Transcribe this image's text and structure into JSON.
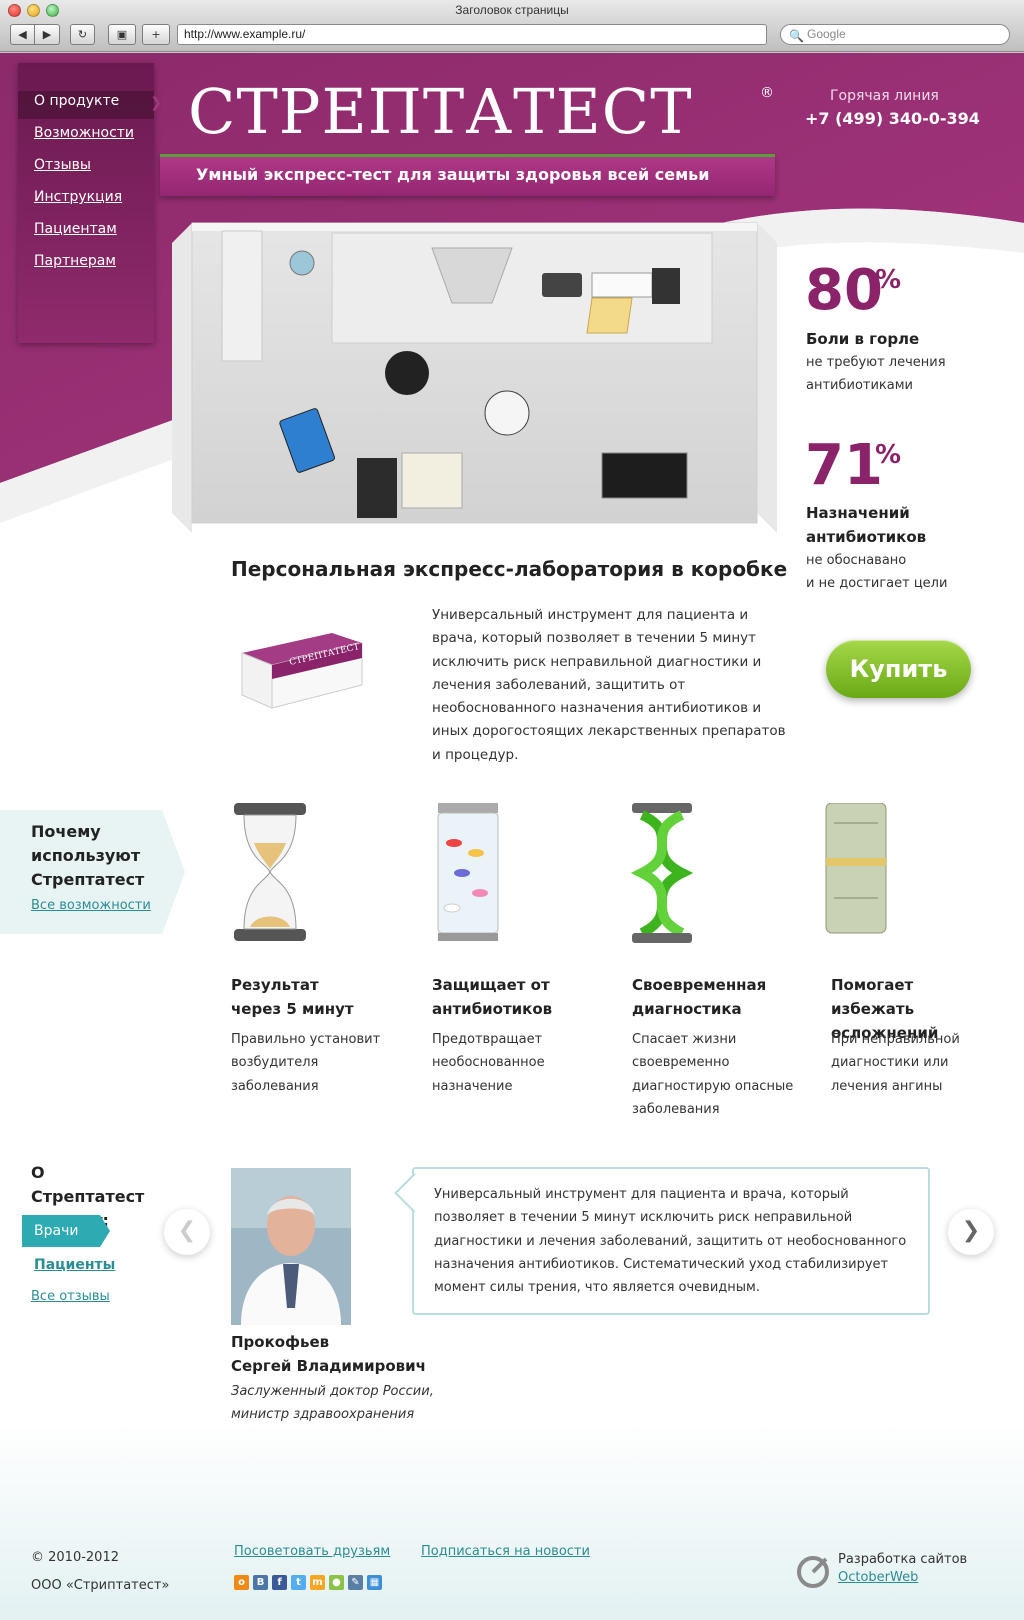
{
  "browser": {
    "window_title": "Заголовок страницы",
    "url": "http://www.example.ru/",
    "search_placeholder": "Google"
  },
  "nav": {
    "items": [
      "О продукте",
      "Возможности",
      "Отзывы",
      "Инструкция",
      "Пациентам",
      "Партнерам"
    ],
    "active_index": 0
  },
  "header": {
    "logo": "СТРЕПТАТЕСТ",
    "reg_mark": "®",
    "hotline_label": "Горячая линия",
    "hotline_phone": "+7 (499) 340-0-394",
    "tagline": "Умный экспресс-тест для защиты здоровья всей семьи"
  },
  "stats": [
    {
      "value": "80",
      "unit": "%",
      "title": "Боли в горле",
      "text_lines": [
        "не требуют лечения",
        "антибиотиками"
      ]
    },
    {
      "value": "71",
      "unit": "%",
      "title_lines": [
        "Назначений",
        "антибиотиков"
      ],
      "text_lines": [
        "не обоснавано",
        "и не достигает цели"
      ]
    }
  ],
  "product": {
    "section_title": "Персональная экспресс-лаборатория в коробке",
    "description": "Универсальный инструмент для пациента и врача, который позволяет в течении 5 минут исключить риск неправильной диагностики и лечения заболеваний, защитить от необоснованного назначения антибиотиков и иных дорогостоящих лекарственных препаратов и процедур.",
    "box_label": "СТРЕПТАТЕСТ",
    "buy_label": "Купить"
  },
  "why": {
    "title": "Почему используют Стрептатест",
    "link": "Все возможности"
  },
  "features": [
    {
      "icon": "hourglass-icon",
      "title": "Результат через 5 минут",
      "text": "Правильно установит возбудителя заболевания"
    },
    {
      "icon": "pills-jar-icon",
      "title": "Защищает от антибиотиков",
      "text": "Предотвращает необоснованное назначение"
    },
    {
      "icon": "dna-helix-icon",
      "title": "Своевременная диагностика",
      "text": "Спасает жизни своевременно диагностирую опасные заболевания"
    },
    {
      "icon": "money-roll-icon",
      "title": "Помогает избежать осложнений",
      "text": "При неправильной диагностики или лечения ангины"
    }
  ],
  "reviews": {
    "title": "О Стрептатест говорят:",
    "tab_doctors": "Врачи",
    "tab_patients": "Пациенты",
    "all_link": "Все отзывы",
    "author_name_lines": [
      "Прокофьев",
      "Сергей Владимирович"
    ],
    "author_role_lines": [
      "Заслуженный доктор России,",
      "министр здравоохранения"
    ],
    "quote": "Универсальный инструмент для пациента и врача, который позволяет в течении 5 минут исключить риск неправильной диагностики и лечения заболеваний, защитить от необоснованного назначения антибиотиков. Систематический уход стабилизирует момент силы трения, что является очевидным."
  },
  "footer": {
    "copyright": "© 2010-2012",
    "company": "ООО «Стриптатест»",
    "recommend_link": "Посоветовать друзьям",
    "subscribe_link": "Подписаться на новости",
    "dev_label": "Разработка сайтов",
    "dev_link": "OctoberWeb"
  },
  "colors": {
    "brand": "#8a2369",
    "accent": "#2eaab3",
    "buy": "#7cba24"
  }
}
